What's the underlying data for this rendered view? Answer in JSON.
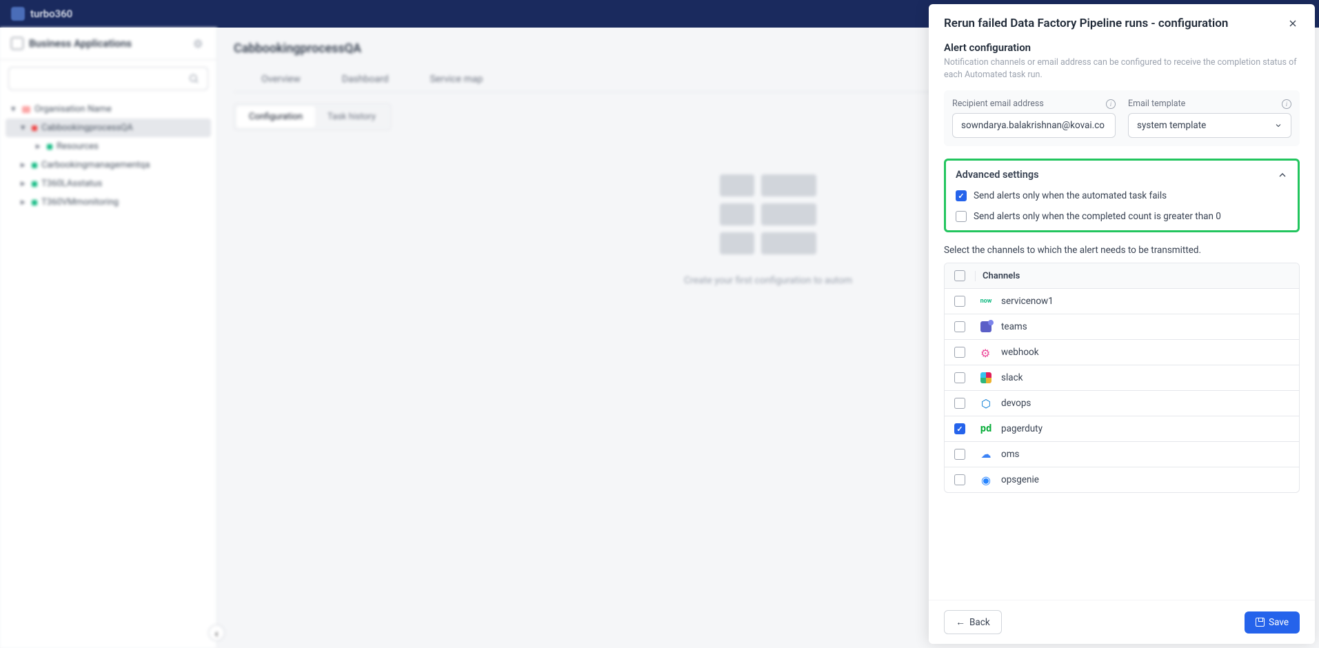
{
  "header": {
    "product": "turbo360"
  },
  "sidebar": {
    "title": "Business Applications",
    "search_placeholder": "",
    "tree": {
      "org": "Organisation Name",
      "items": [
        {
          "label": "CabbookingprocessQA",
          "active": true
        },
        {
          "label": "Resources",
          "indent": true
        },
        {
          "label": "Carbookingmanagementqa"
        },
        {
          "label": "T360LAsstatus"
        },
        {
          "label": "T360VMmonitoring"
        }
      ]
    }
  },
  "main": {
    "title": "CabbookingprocessQA",
    "tabs": [
      "Overview",
      "Dashboard",
      "Service map"
    ],
    "seg_tabs": {
      "configuration": "Configuration",
      "task_history": "Task history"
    },
    "placeholder_caption": "Create your first configuration to autom"
  },
  "drawer": {
    "title": "Rerun failed Data Factory Pipeline runs - configuration",
    "alert_config": {
      "heading": "Alert configuration",
      "sub": "Notification channels or email address can be configured to receive the completion status of each Automated task run."
    },
    "email_field": {
      "label": "Recipient email address",
      "value": "sowndarya.balakrishnan@kovai.co"
    },
    "template_field": {
      "label": "Email template",
      "value": "system template"
    },
    "advanced": {
      "title": "Advanced settings",
      "opt1": {
        "label": "Send alerts only when the automated task fails",
        "checked": true
      },
      "opt2": {
        "label": "Send alerts only when the completed count is greater than 0",
        "checked": false
      }
    },
    "channel_instr": "Select the channels to which the alert needs to be transmitted.",
    "channel_header": "Channels",
    "channels": [
      {
        "name": "servicenow1",
        "checked": false
      },
      {
        "name": "teams",
        "checked": false
      },
      {
        "name": "webhook",
        "checked": false
      },
      {
        "name": "slack",
        "checked": false
      },
      {
        "name": "devops",
        "checked": false
      },
      {
        "name": "pagerduty",
        "checked": true
      },
      {
        "name": "oms",
        "checked": false
      },
      {
        "name": "opsgenie",
        "checked": false
      }
    ],
    "footer": {
      "back": "Back",
      "save": "Save"
    }
  }
}
